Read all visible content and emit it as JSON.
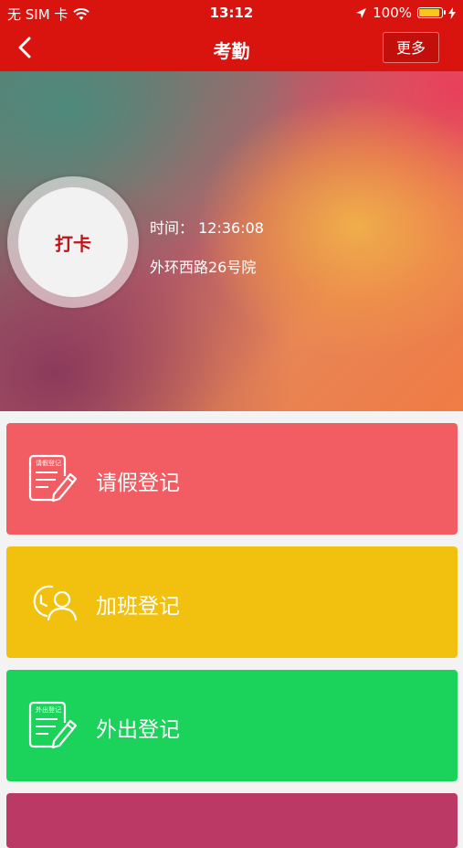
{
  "status_bar": {
    "carrier": "无 SIM 卡",
    "time": "13:12",
    "battery": "100%"
  },
  "nav": {
    "title": "考勤",
    "more_label": "更多"
  },
  "hero": {
    "punch_label": "打卡",
    "time_text": "时间： 12:36:08",
    "address": "外环西路26号院"
  },
  "menu": {
    "leave": {
      "label": "请假登记",
      "icon_text": "请假登记",
      "color": "#f15d63"
    },
    "overtime": {
      "label": "加班登记",
      "color": "#f2c10f"
    },
    "out": {
      "label": "外出登记",
      "icon_text": "外出登记",
      "color": "#1bd25b"
    },
    "fourth": {
      "color": "#ba3a65"
    }
  },
  "colors": {
    "brand_red": "#d9140f"
  }
}
